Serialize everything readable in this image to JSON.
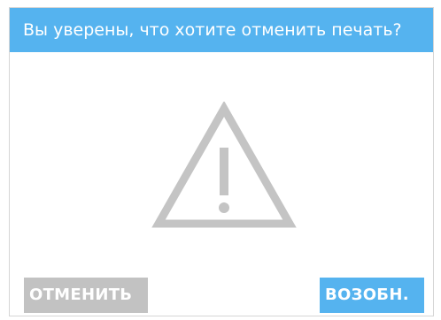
{
  "dialog": {
    "title": "Вы уверены, что хотите отменить печать?",
    "icon": "warning-triangle-icon",
    "buttons": {
      "cancel_label": "ОТМЕНИТЬ",
      "resume_label": "ВОЗОБН."
    }
  },
  "colors": {
    "accent": "#55b3ef",
    "cancel_button": "#c2c2c2",
    "icon": "#c4c4c4"
  }
}
